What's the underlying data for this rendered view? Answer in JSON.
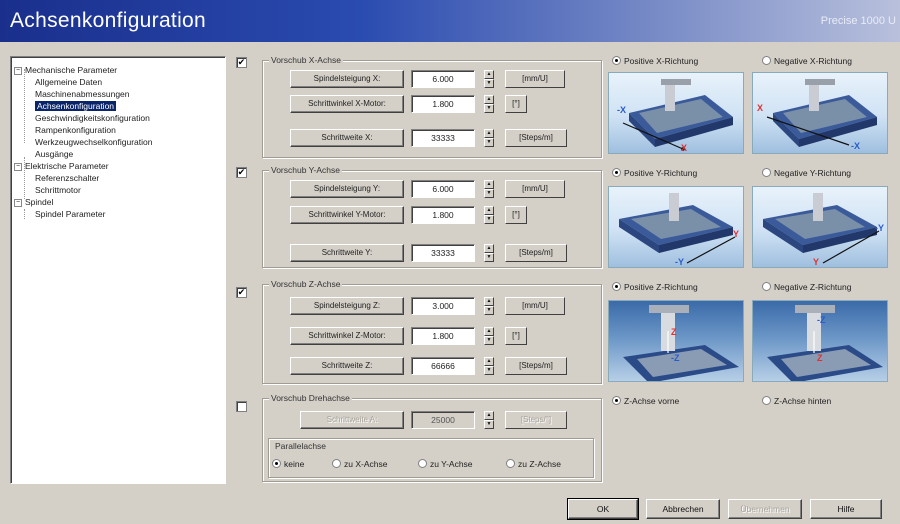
{
  "window": {
    "title": "Achsenkonfiguration",
    "subtitle": "Precise 1000 U"
  },
  "tree": {
    "nodes": [
      {
        "label": "Mechanische Parameter",
        "sign": "−"
      },
      {
        "label": "Allgemeine Daten"
      },
      {
        "label": "Maschinenabmessungen"
      },
      {
        "label": "Achsenkonfiguration",
        "selected": true
      },
      {
        "label": "Geschwindigkeitskonfiguration"
      },
      {
        "label": "Rampenkonfiguration"
      },
      {
        "label": "Werkzeugwechselkonfiguration"
      },
      {
        "label": "Ausgänge"
      },
      {
        "label": "Elektrische Parameter",
        "sign": "−"
      },
      {
        "label": "Referenzschalter"
      },
      {
        "label": "Schrittmotor"
      },
      {
        "label": "Spindel",
        "sign": "−"
      },
      {
        "label": "Spindel Parameter"
      }
    ]
  },
  "axes": {
    "x": {
      "checked": "✔",
      "group": "Vorschub X-Achse",
      "pitch_label": "Spindelsteigung X:",
      "pitch_value": "6.000",
      "pitch_unit": "[mm/U]",
      "angle_label": "Schrittwinkel X-Motor:",
      "angle_value": "1.800",
      "angle_unit": "[°]",
      "step_label": "Schrittweite X:",
      "step_value": "33333",
      "step_unit": "[Steps/m]",
      "pos_label": "Positive X-Richtung",
      "neg_label": "Negative X-Richtung",
      "pos_selected": true
    },
    "y": {
      "checked": "✔",
      "group": "Vorschub Y-Achse",
      "pitch_label": "Spindelsteigung Y:",
      "pitch_value": "6.000",
      "pitch_unit": "[mm/U]",
      "angle_label": "Schrittwinkel Y-Motor:",
      "angle_value": "1.800",
      "angle_unit": "[°]",
      "step_label": "Schrittweite Y:",
      "step_value": "33333",
      "step_unit": "[Steps/m]",
      "pos_label": "Positive Y-Richtung",
      "neg_label": "Negative Y-Richtung",
      "pos_selected": true
    },
    "z": {
      "checked": "✔",
      "group": "Vorschub Z-Achse",
      "pitch_label": "Spindelsteigung Z:",
      "pitch_value": "3.000",
      "pitch_unit": "[mm/U]",
      "angle_label": "Schrittwinkel Z-Motor:",
      "angle_value": "1.800",
      "angle_unit": "[°]",
      "step_label": "Schrittweite Z:",
      "step_value": "66666",
      "step_unit": "[Steps/m]",
      "pos_label": "Positive Z-Richtung",
      "neg_label": "Negative Z-Richtung",
      "pos_selected": true
    },
    "rot": {
      "checked": "",
      "group": "Vorschub Drehachse",
      "step_label": "Schrittweite A:",
      "step_value": "25000",
      "step_unit": "[Steps/°]"
    }
  },
  "z_mount": {
    "front": "Z-Achse vorne",
    "back": "Z-Achse hinten",
    "front_selected": true
  },
  "parallel": {
    "title": "Parallelachse",
    "options": [
      "keine",
      "zu X-Achse",
      "zu Y-Achse",
      "zu Z-Achse"
    ],
    "selected": 0
  },
  "buttons": {
    "ok": "OK",
    "cancel": "Abbrechen",
    "apply": "Übernehmen",
    "help": "Hilfe"
  },
  "pic_labels": {
    "x": "X",
    "y": "Y",
    "z": "Z",
    "neg_x": "-X",
    "neg_y": "-Y",
    "neg_z": "-Z"
  },
  "colors": {
    "title_start": "#1a2f8c",
    "arrow_pos": "#e23030",
    "arrow_neg": "#2a5cc8",
    "machine": "#3a5a9a"
  }
}
